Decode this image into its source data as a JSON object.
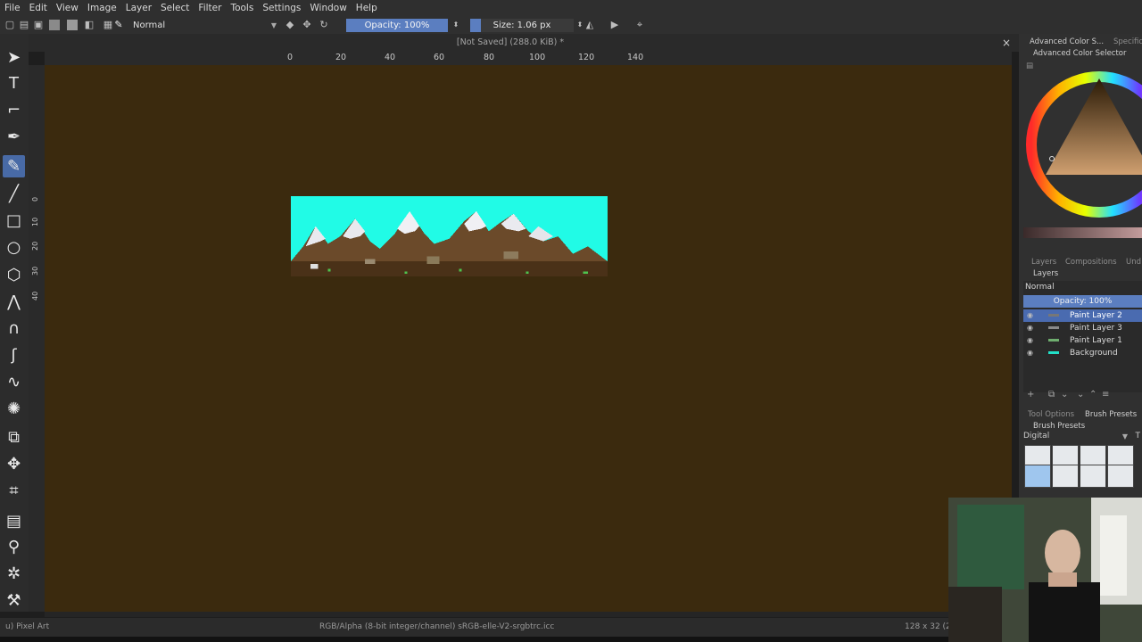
{
  "menu": [
    "File",
    "Edit",
    "View",
    "Image",
    "Layer",
    "Select",
    "Filter",
    "Tools",
    "Settings",
    "Window",
    "Help"
  ],
  "toolbar": {
    "blend_mode": "Normal",
    "opacity": "Opacity: 100%",
    "size": "Size: 1.06 px"
  },
  "document": {
    "title": "[Not Saved]  (288.0 KiB) *",
    "close": "×"
  },
  "ruler_h": [
    "0",
    "20",
    "40",
    "60",
    "80",
    "100",
    "120",
    "140"
  ],
  "ruler_v": [
    "0",
    "10",
    "20",
    "30",
    "40"
  ],
  "dock": {
    "color_tabs": [
      "Advanced Color S...",
      "Specific"
    ],
    "color_panel_title": "Advanced Color Selector",
    "layer_tabs": [
      "Layers",
      "Compositions",
      "Und"
    ],
    "layers_panel_title": "Layers",
    "layer_blend": "Normal",
    "layer_opacity": "Opacity:  100%",
    "layers": [
      {
        "name": "Paint Layer 2",
        "selected": true,
        "thumb": "#777777"
      },
      {
        "name": "Paint Layer 3",
        "selected": false,
        "thumb": "#8a8a8a"
      },
      {
        "name": "Paint Layer 1",
        "selected": false,
        "thumb": "#6fae6f"
      },
      {
        "name": "Background",
        "selected": false,
        "thumb": "#22e0c8"
      }
    ],
    "brush_tabs": [
      "Tool Options",
      "Brush Presets"
    ],
    "brush_panel_title": "Brush Presets",
    "brush_category": "Digital",
    "brush_tag": "T"
  },
  "status": {
    "brush": "u) Pixel Art",
    "color_space": "RGB/Alpha (8-bit integer/channel)  sRGB-elle-V2-srgbtrc.icc",
    "dimensions": "128 x 32 (2"
  },
  "colors": {
    "canvas_bg": "#3b2a0e",
    "sky": "#21fbe6",
    "accent": "#5b7ec0"
  }
}
